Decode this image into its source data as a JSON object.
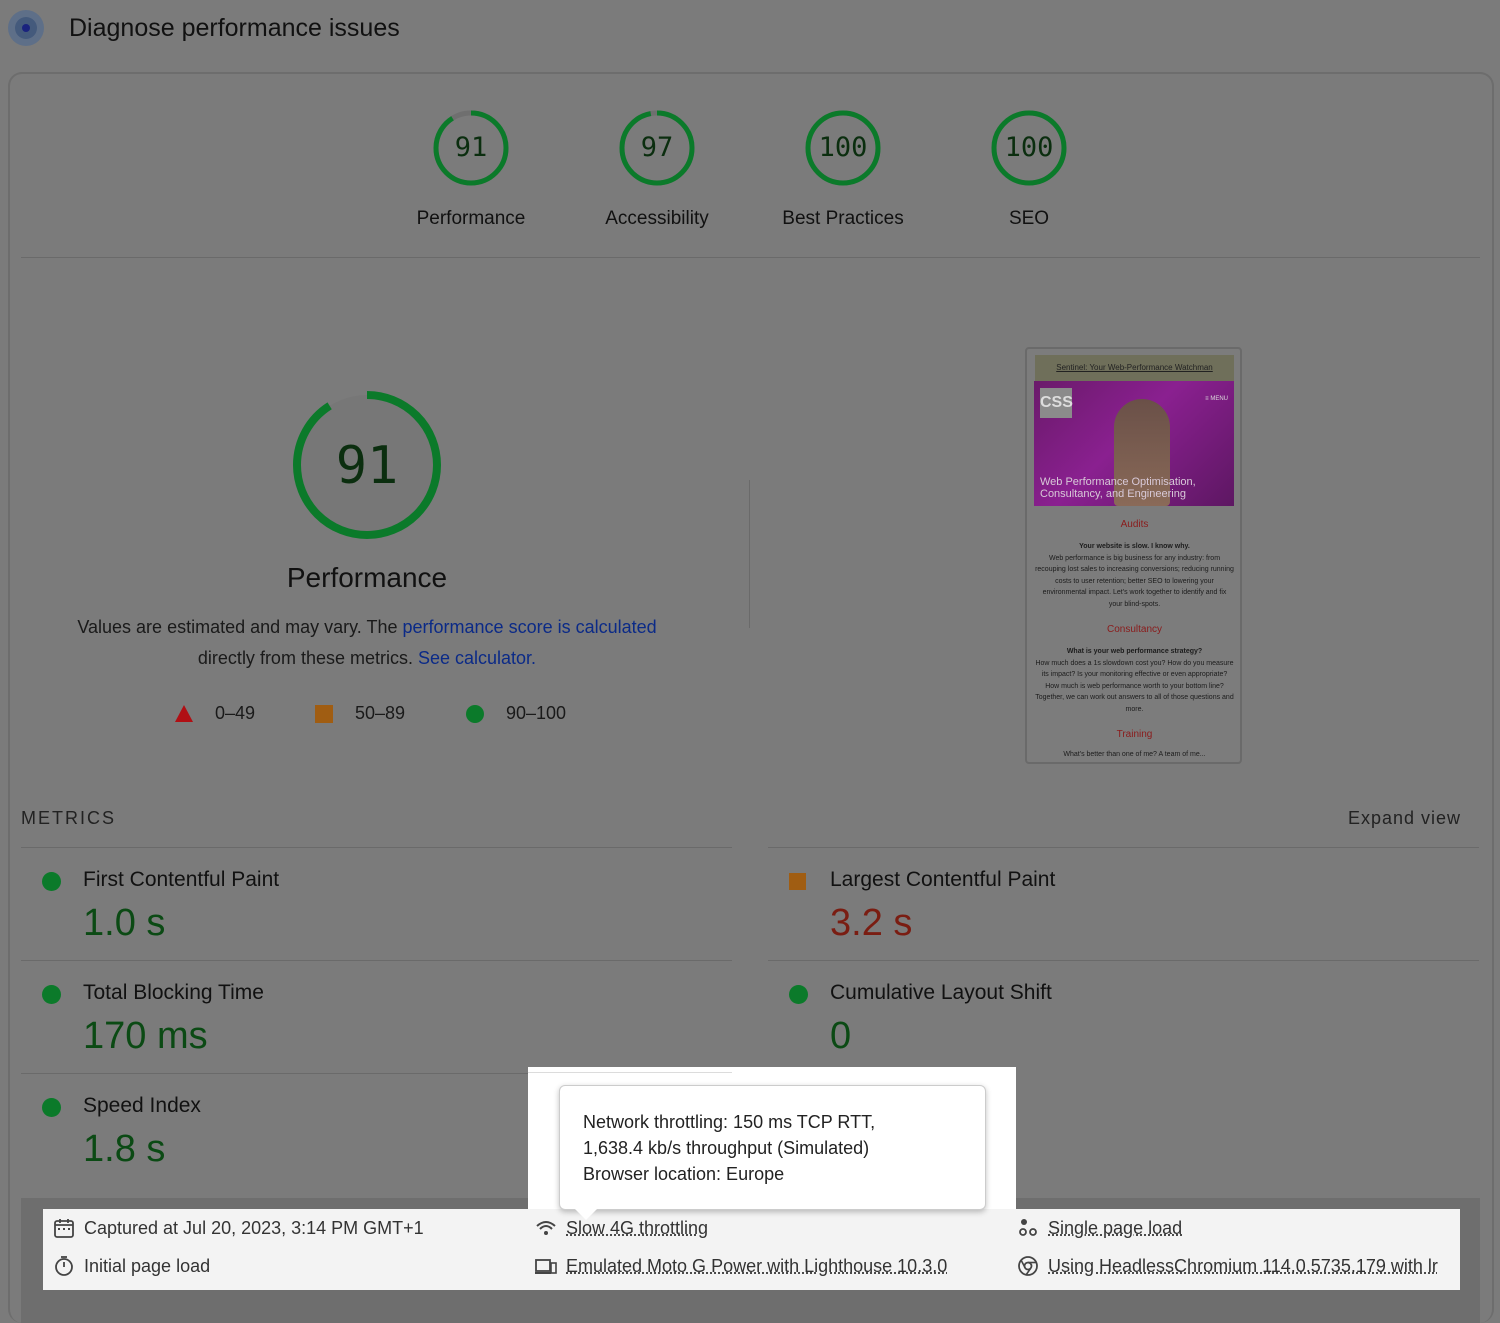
{
  "header": {
    "title": "Diagnose performance issues"
  },
  "gauges": [
    {
      "score": "91",
      "label": "Performance",
      "fill": 0.91
    },
    {
      "score": "97",
      "label": "Accessibility",
      "fill": 0.97
    },
    {
      "score": "100",
      "label": "Best Practices",
      "fill": 1.0
    },
    {
      "score": "100",
      "label": "SEO",
      "fill": 1.0
    }
  ],
  "performance": {
    "score": "91",
    "fill": 0.91,
    "title": "Performance",
    "desc_text1": "Values are estimated and may vary. The ",
    "desc_link1": "performance score is calculated",
    "desc_text2": "directly from these metrics. ",
    "desc_link2": "See calculator."
  },
  "legend": {
    "fail": "0–49",
    "average": "50–89",
    "pass": "90–100"
  },
  "screenshot": {
    "heading": "Sentinel: Your Web-Performance Watchman",
    "logo": "CSS",
    "menu": "≡ MENU",
    "hero_text": "Web Performance Optimisation, Consultancy, and Engineering",
    "section1": "Audits",
    "body1_bold": "Your website is slow. I know why.",
    "body1": "Web performance is big business for any industry: from recouping lost sales to increasing conversions; reducing running costs to user retention; better SEO to lowering your environmental impact. Let's work together to identify and fix your blind-spots.",
    "section2": "Consultancy",
    "body2_bold": "What is your web performance strategy?",
    "body2": "How much does a 1s slowdown cost you? How do you measure its impact? Is your monitoring effective or even appropriate? How much is web performance worth to your bottom line? Together, we can work out answers to all of those questions and more.",
    "section3": "Training",
    "body3": "What's better than one of me? A team of me..."
  },
  "metrics": {
    "title": "METRICS",
    "expand": "Expand view",
    "items": [
      {
        "name": "First Contentful Paint",
        "value": "1.0 s",
        "rating": "pass"
      },
      {
        "name": "Largest Contentful Paint",
        "value": "3.2 s",
        "rating": "average"
      },
      {
        "name": "Total Blocking Time",
        "value": "170 ms",
        "rating": "pass"
      },
      {
        "name": "Cumulative Layout Shift",
        "value": "0",
        "rating": "pass"
      },
      {
        "name": "Speed Index",
        "value": "1.8 s",
        "rating": "pass"
      }
    ]
  },
  "footer": {
    "captured": "Captured at Jul 20, 2023, 3:14 PM GMT+1",
    "initial": "Initial page load",
    "throttling": "Slow 4G throttling",
    "device": "Emulated Moto G Power with Lighthouse 10.3.0",
    "single": "Single page load",
    "browser": "Using HeadlessChromium 114.0.5735.179 with lr"
  },
  "tooltip": {
    "line1": "Network throttling: 150 ms TCP RTT,",
    "line2": "1,638.4 kb/s throughput (Simulated)",
    "line3": "Browser location: Europe"
  },
  "colors": {
    "pass": "#0b7a2a",
    "average": "#a05d12",
    "fail": "#b00f14",
    "link": "#0b2a87"
  }
}
